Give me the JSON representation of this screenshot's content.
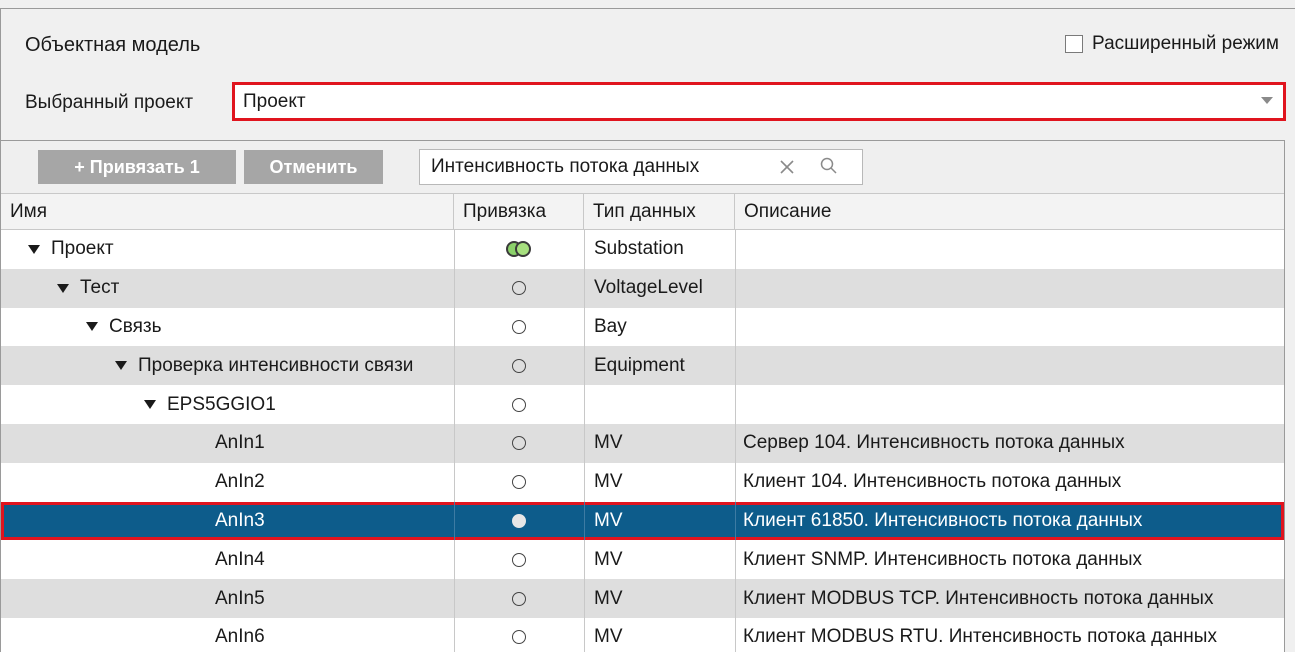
{
  "panel": {
    "title": "Объектная модель",
    "advanced_mode_label": "Расширенный режим",
    "project_label": "Выбранный проект",
    "project_value": "Проект"
  },
  "toolbar": {
    "bind_label": "+ Привязать 1",
    "cancel_label": "Отменить",
    "search_value": "Интенсивность потока данных"
  },
  "columns": {
    "name": "Имя",
    "binding": "Привязка",
    "data_type": "Тип данных",
    "description": "Описание"
  },
  "rows": [
    {
      "name": "Проект",
      "level": 0,
      "expanded": true,
      "binding": "bound",
      "type": "Substation",
      "desc": ""
    },
    {
      "name": "Тест",
      "level": 1,
      "expanded": true,
      "binding": "empty",
      "type": "VoltageLevel",
      "desc": ""
    },
    {
      "name": "Связь",
      "level": 2,
      "expanded": true,
      "binding": "empty",
      "type": "Bay",
      "desc": ""
    },
    {
      "name": "Проверка интенсивности связи",
      "level": 3,
      "expanded": true,
      "binding": "empty",
      "type": "Equipment",
      "desc": ""
    },
    {
      "name": "EPS5GGIO1",
      "level": 4,
      "expanded": true,
      "binding": "empty",
      "type": "",
      "desc": ""
    },
    {
      "name": "AnIn1",
      "level": 5,
      "expanded": false,
      "binding": "empty",
      "type": "MV",
      "desc": "Сервер 104. Интенсивность потока данных"
    },
    {
      "name": "AnIn2",
      "level": 5,
      "expanded": false,
      "binding": "empty",
      "type": "MV",
      "desc": "Клиент 104. Интенсивность потока данных"
    },
    {
      "name": "AnIn3",
      "level": 5,
      "expanded": false,
      "binding": "filled",
      "type": "MV",
      "desc": "Клиент 61850. Интенсивность потока данных",
      "selected": true
    },
    {
      "name": "AnIn4",
      "level": 5,
      "expanded": false,
      "binding": "empty",
      "type": "MV",
      "desc": "Клиент SNMP. Интенсивность потока данных"
    },
    {
      "name": "AnIn5",
      "level": 5,
      "expanded": false,
      "binding": "empty",
      "type": "MV",
      "desc": "Клиент MODBUS TCP. Интенсивность потока данных"
    },
    {
      "name": "AnIn6",
      "level": 5,
      "expanded": false,
      "binding": "empty",
      "type": "MV",
      "desc": "Клиент MODBUS RTU. Интенсивность потока данных"
    }
  ],
  "colors": {
    "selected_row": "#0d5c8b",
    "highlight_border": "#e0141e",
    "button_bg": "#a6a6a6"
  }
}
